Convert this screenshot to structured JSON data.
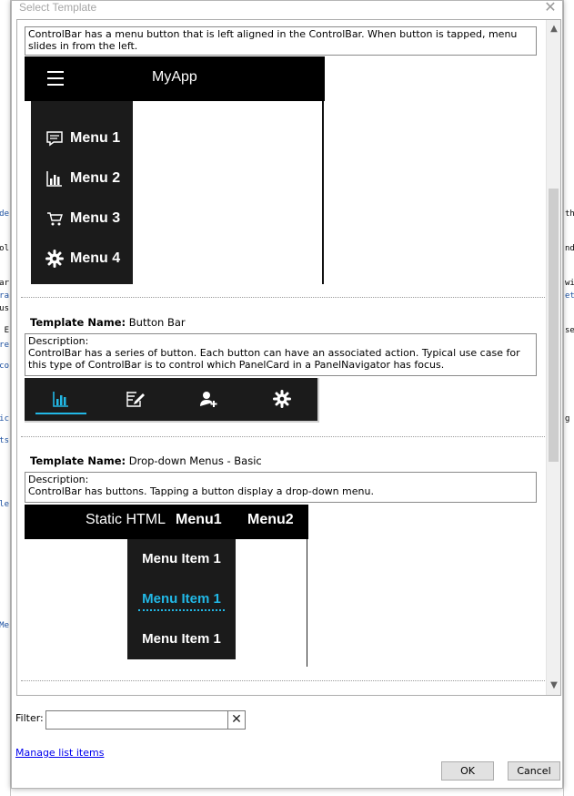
{
  "dialog": {
    "title": "Select Template",
    "close_glyph": "✕"
  },
  "templates": [
    {
      "description": "ControlBar has a menu button that is left aligned in the ControlBar. When button is tapped, menu slides in from the left.",
      "preview": {
        "app_title": "MyApp",
        "menu_items": [
          {
            "label": "Menu 1",
            "icon": "message-icon"
          },
          {
            "label": "Menu 2",
            "icon": "bar-chart-icon"
          },
          {
            "label": "Menu 3",
            "icon": "cart-icon"
          },
          {
            "label": "Menu 4",
            "icon": "gear-icon"
          }
        ]
      }
    },
    {
      "name_label": "Template Name:",
      "name": "Button Bar",
      "description_label": "Description:",
      "description": "ControlBar has a series of button. Each button can have an associated action. Typical use case for this type of ControlBar is to control which PanelCard in a PanelNavigator has focus.",
      "preview": {
        "buttons": [
          {
            "icon": "bar-chart-icon",
            "active": true
          },
          {
            "icon": "edit-icon",
            "active": false
          },
          {
            "icon": "add-user-icon",
            "active": false
          },
          {
            "icon": "gear-icon",
            "active": false
          }
        ],
        "accent_color": "#22b8e6"
      }
    },
    {
      "name_label": "Template Name:",
      "name": "Drop-down Menus - Basic",
      "description_label": "Description:",
      "description": "ControlBar has buttons. Tapping a button display a drop-down menu.",
      "preview": {
        "static_label": "Static HTML",
        "menu1": "Menu1",
        "menu2": "Menu2",
        "dropdown_items": [
          {
            "label": "Menu Item 1",
            "active": false
          },
          {
            "label": "Menu Item 1",
            "active": true
          },
          {
            "label": "Menu Item 1",
            "active": false
          }
        ]
      }
    }
  ],
  "filter": {
    "label": "Filter:",
    "value": "",
    "clear_glyph": "✕"
  },
  "manage_link": "Manage list items",
  "buttons": {
    "ok": "OK",
    "cancel": "Cancel"
  },
  "background_fragments": {
    "left": [
      "de",
      "trol",
      "car",
      "ra",
      "us",
      ". E",
      "ore",
      "co",
      "sic",
      "ts",
      "le",
      "Me"
    ],
    "right": [
      "th",
      "nd",
      "wi",
      "et",
      "se",
      "g"
    ]
  }
}
